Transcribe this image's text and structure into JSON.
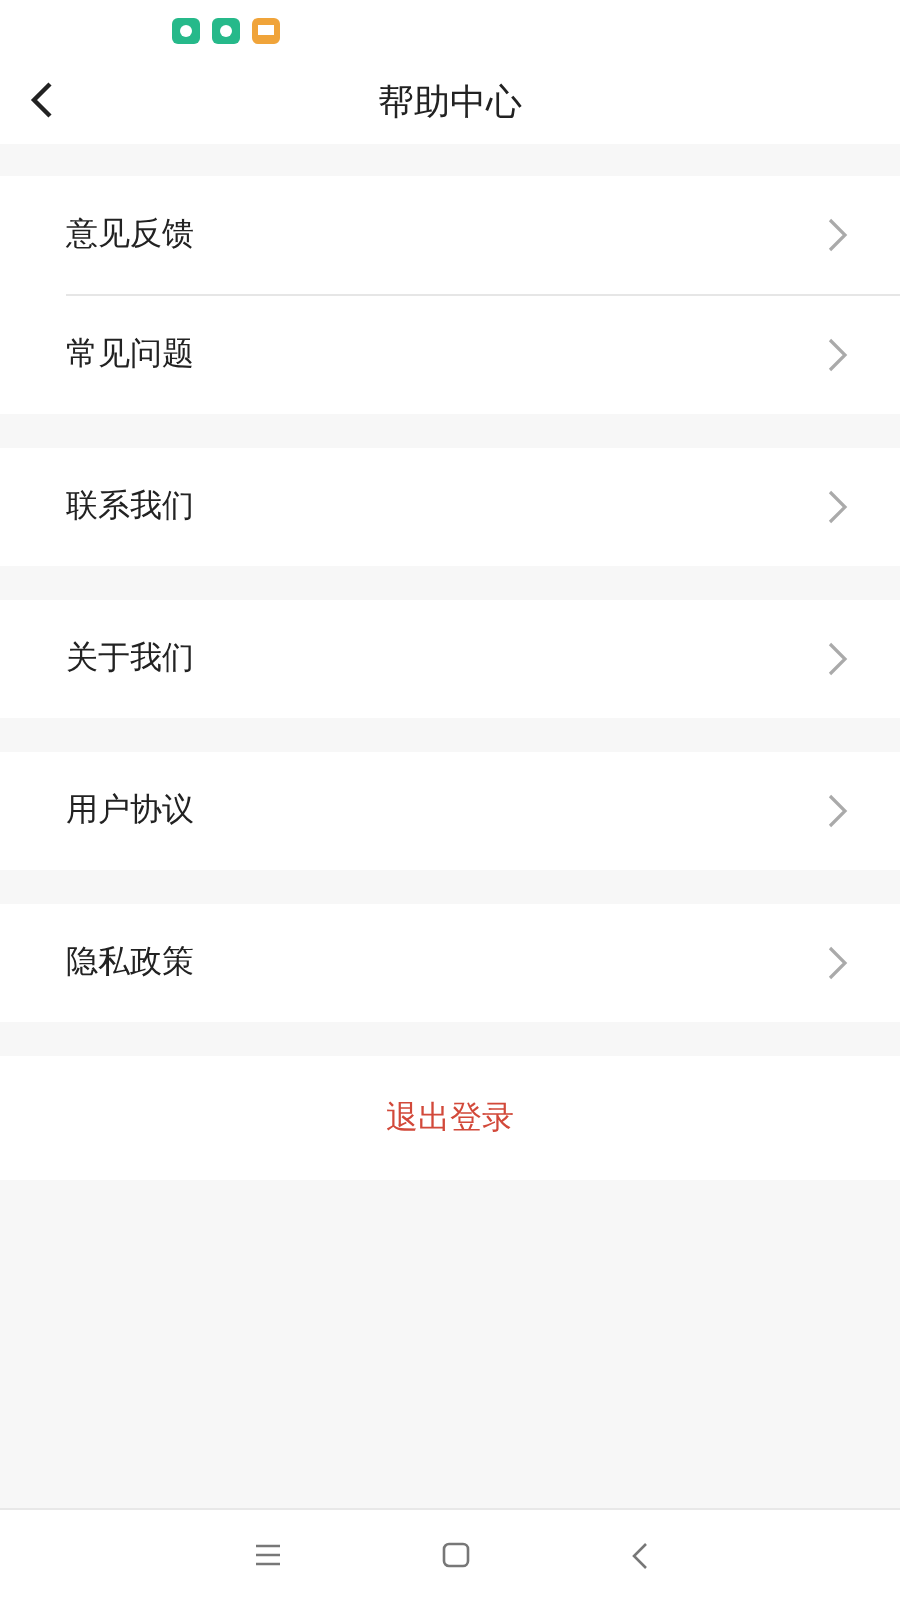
{
  "header": {
    "title": "帮助中心"
  },
  "groups": [
    {
      "items": [
        "意见反馈",
        "常见问题"
      ]
    },
    {
      "items": [
        "联系我们"
      ]
    },
    {
      "items": [
        "关于我们"
      ]
    },
    {
      "items": [
        "用户协议"
      ]
    },
    {
      "items": [
        "隐私政策"
      ]
    }
  ],
  "logout": {
    "label": "退出登录"
  }
}
